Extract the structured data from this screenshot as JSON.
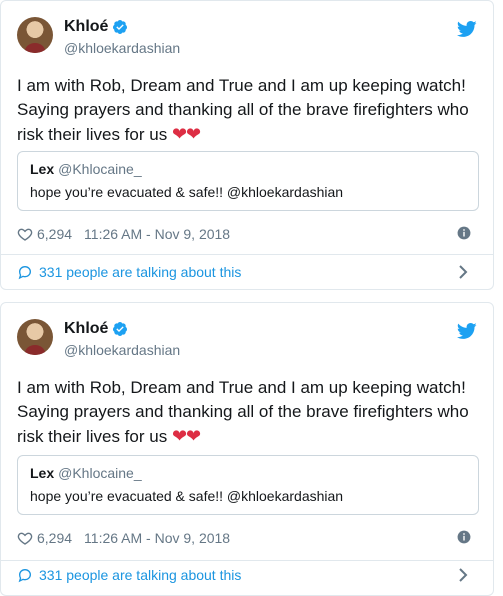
{
  "tweets": [
    {
      "author": {
        "name": "Khloé",
        "handle": "@khloekardashian"
      },
      "text_main": "I am with Rob, Dream and True and I am up keeping watch! Saying prayers and thanking all of the brave firefighters who risk their lives for us ",
      "hearts": "❤❤",
      "quoted": {
        "name": "Lex",
        "handle": "@Khlocaine_",
        "text": "hope you’re evacuated & safe!! @khloekardashian"
      },
      "likes": "6,294",
      "timestamp": "11:26 AM - Nov 9, 2018",
      "talking": "331 people are talking about this"
    },
    {
      "author": {
        "name": "Khloé",
        "handle": "@khloekardashian"
      },
      "text_main": "I am with Rob, Dream and True and I am up keeping watch! Saying prayers and thanking all of the brave firefighters who risk their lives for us ",
      "hearts": "❤❤",
      "quoted": {
        "name": "Lex",
        "handle": "@Khlocaine_",
        "text": "hope you’re evacuated & safe!! @khloekardashian"
      },
      "likes": "6,294",
      "timestamp": "11:26 AM - Nov 9, 2018",
      "talking": "331 people are talking about this"
    }
  ],
  "colors": {
    "link": "#1b95e0",
    "muted": "#657786",
    "border": "#e1e8ed",
    "heart_emoji": "#dd2e44",
    "verified": "#1da1f2"
  },
  "icons": [
    "verified-badge-icon",
    "twitter-bird-icon",
    "heart-outline-icon",
    "info-icon",
    "speech-bubble-icon",
    "chevron-right-icon"
  ]
}
